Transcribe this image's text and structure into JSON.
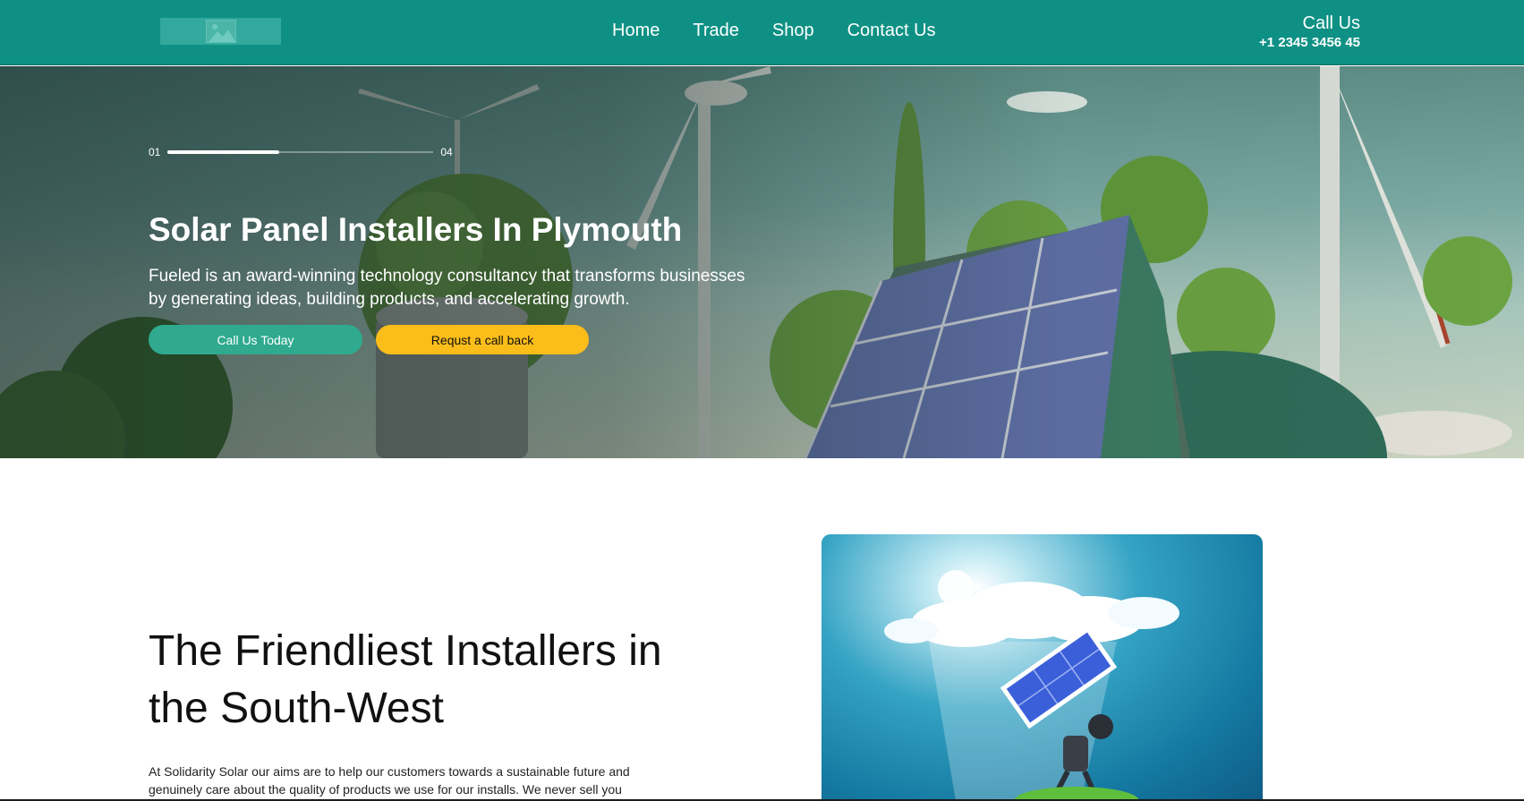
{
  "header": {
    "nav": [
      "Home",
      "Trade",
      "Shop",
      "Contact Us"
    ],
    "call_label": "Call Us",
    "phone": "+1 2345 3456 45"
  },
  "hero": {
    "slide_current": "01",
    "slide_total": "04",
    "slide_progress": 0.42,
    "title": "Solar Panel Installers In Plymouth",
    "subtitle": "Fueled is an award-winning technology consultancy that transforms businesses by generating ideas, building products, and accelerating growth.",
    "primary_button": "Call Us Today",
    "secondary_button": "Requst a call back"
  },
  "intro": {
    "title": "The Friendliest Installers in the South-West",
    "text": "At Solidarity Solar our aims are to help our customers towards a sustainable future and genuinely care about the quality of products we use for our installs. We never sell you"
  },
  "colors": {
    "header": "#0e9184",
    "primary_button": "#2faa8e",
    "secondary_button": "#fbbd1a"
  }
}
